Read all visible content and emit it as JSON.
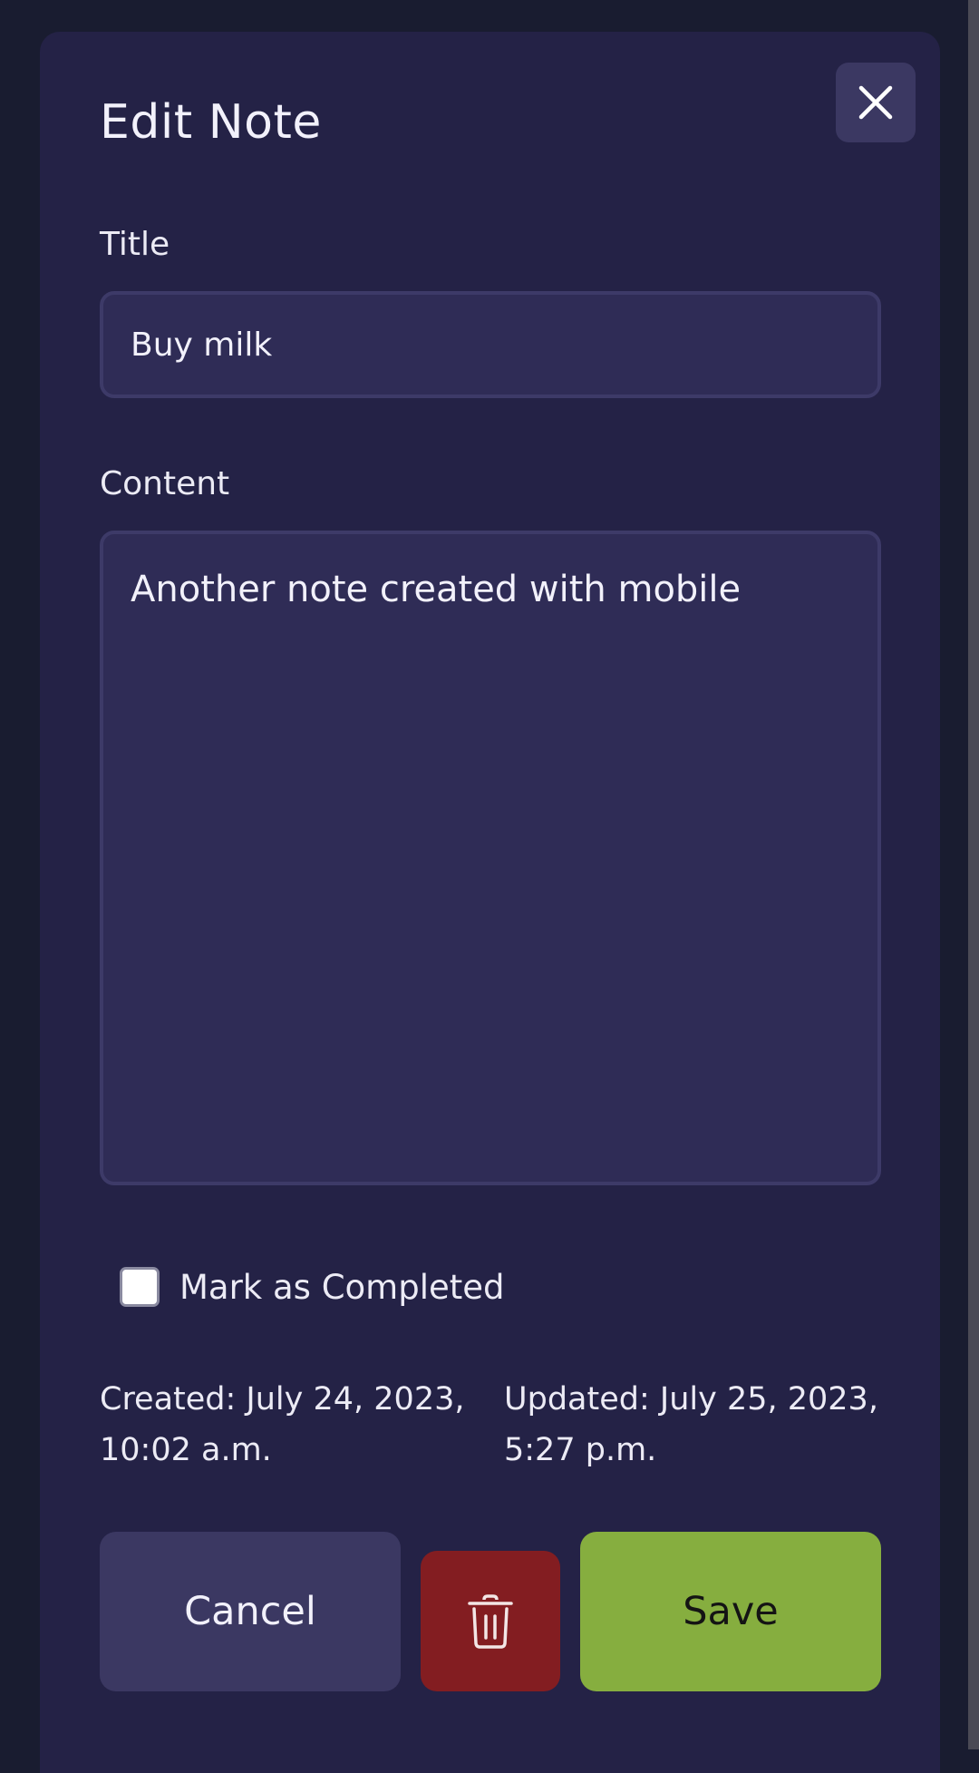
{
  "modal": {
    "title": "Edit Note",
    "close_icon": "close-icon"
  },
  "form": {
    "title_label": "Title",
    "title_value": "Buy milk",
    "content_label": "Content",
    "content_value": "Another note created with mobile",
    "completed_label": "Mark as Completed",
    "completed_checked": false
  },
  "meta": {
    "created": "Created: July 24, 2023, 10:02 a.m.",
    "updated": "Updated: July 25, 2023, 5:27 p.m."
  },
  "actions": {
    "cancel_label": "Cancel",
    "delete_icon": "trash-icon",
    "save_label": "Save"
  },
  "colors": {
    "background": "#191c30",
    "modal": "#242246",
    "input": "#2f2c56",
    "secondary_button": "#3b3862",
    "delete_button": "#831d21",
    "save_button": "#86ae3f"
  }
}
